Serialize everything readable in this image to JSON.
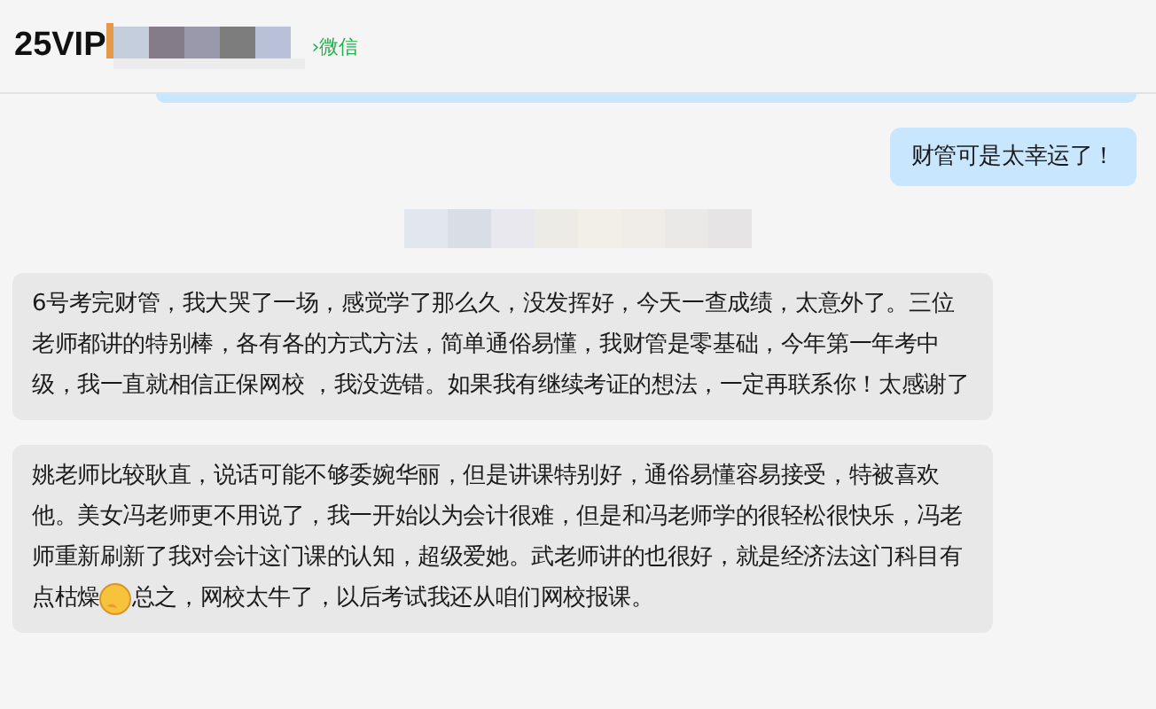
{
  "header": {
    "title": "25VIP",
    "source_link": "›微信"
  },
  "messages": [
    {
      "outgoing": true,
      "kind": "clipped"
    },
    {
      "outgoing": true,
      "kind": "text",
      "segments": [
        {
          "kind": "text",
          "text": "财管可是太幸运了！"
        }
      ]
    },
    {
      "kind": "redacted"
    },
    {
      "outgoing": false,
      "kind": "text",
      "segments": [
        {
          "kind": "text",
          "text": "6号考完财管，我大哭了一场，感觉学了那么久，没发挥好，今天一查成绩，太意外了。三位老师都讲的特别棒，各有各的方式方法，简单通俗易懂，我财管是零基础，今年第一年考中级，我一直就相信正保网校 ，我没选错。如果我有继续考证的想法，一定再联系你！太感谢了"
        }
      ]
    },
    {
      "outgoing": false,
      "kind": "text",
      "segments": [
        {
          "kind": "text",
          "text": "姚老师比较耿直，说话可能不够委婉华丽，但是讲课特别好，通俗易懂容易接受，特被喜欢他。美女冯老师更不用说了，我一开始以为会计很难，但是和冯老师学的很轻松很快乐，冯老师重新刷新了我对会计这门课的认知，超级爱她。武老师讲的也很好，就是经济法这门科目有"
        },
        {
          "kind": "line",
          "parts": [
            {
              "kind": "text",
              "text": "点枯燥"
            },
            {
              "kind": "emoji"
            },
            {
              "kind": "text",
              "text": "总之，网校太牛了，以后考试我还从咱们网校报课。"
            }
          ]
        }
      ]
    }
  ]
}
